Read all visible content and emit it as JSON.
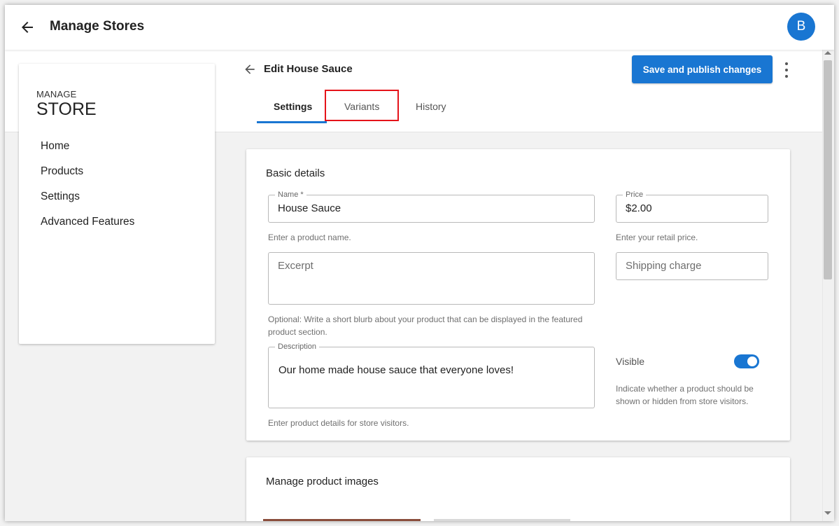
{
  "app": {
    "title": "Manage Stores",
    "avatar_initial": "B"
  },
  "sidebar": {
    "brand_small": "MANAGE",
    "brand_large": "STORE",
    "items": [
      {
        "label": "Home"
      },
      {
        "label": "Products"
      },
      {
        "label": "Settings"
      },
      {
        "label": "Advanced Features"
      }
    ]
  },
  "editor": {
    "title": "Edit House Sauce",
    "save_label": "Save and publish changes",
    "tabs": [
      {
        "label": "Settings",
        "active": true
      },
      {
        "label": "Variants",
        "active": false
      },
      {
        "label": "History",
        "active": false
      }
    ]
  },
  "basic_details": {
    "title": "Basic details",
    "name": {
      "label": "Name *",
      "value": "House Sauce",
      "helper": "Enter a product name."
    },
    "price": {
      "label": "Price",
      "value": "$2.00",
      "helper": "Enter your retail price."
    },
    "excerpt": {
      "placeholder": "Excerpt",
      "helper": "Optional: Write a short blurb about your product that can be displayed in the featured product section."
    },
    "shipping": {
      "placeholder": "Shipping charge"
    },
    "description": {
      "label": "Description",
      "value": "Our home made house sauce that everyone loves!",
      "helper": "Enter product details for store visitors."
    },
    "visible": {
      "label": "Visible",
      "on": true,
      "helper": "Indicate whether a product should be shown or hidden from store visitors."
    }
  },
  "images": {
    "title": "Manage product images"
  },
  "colors": {
    "accent": "#1976d2",
    "highlight": "#e5131a"
  },
  "icons": {
    "back": "arrow-left-icon",
    "more": "more-vert-icon"
  }
}
